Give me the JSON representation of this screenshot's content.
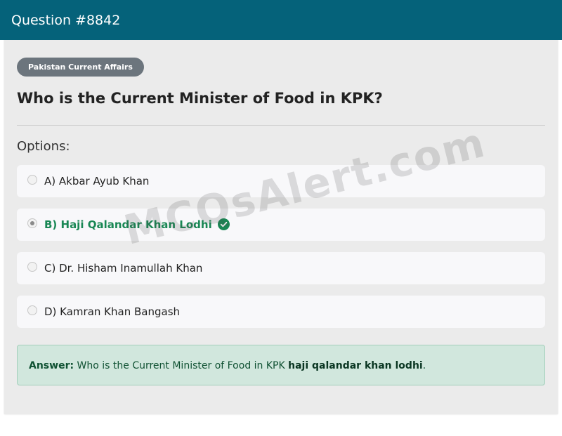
{
  "header": {
    "title": "Question #8842"
  },
  "category": "Pakistan Current Affairs",
  "question": "Who is the Current Minister of Food in KPK?",
  "options_label": "Options:",
  "options": [
    {
      "label": "A) Akbar Ayub Khan",
      "selected": false,
      "correct": false
    },
    {
      "label": "B) Haji Qalandar Khan Lodhi",
      "selected": true,
      "correct": true
    },
    {
      "label": "C) Dr. Hisham Inamullah Khan",
      "selected": false,
      "correct": false
    },
    {
      "label": "D) Kamran Khan Bangash",
      "selected": false,
      "correct": false
    }
  ],
  "answer": {
    "label": "Answer:",
    "text": "Who is the Current Minister of Food in KPK",
    "value": "haji qalandar khan lodhi",
    "suffix": "."
  },
  "watermark": "MCQsAlert.com",
  "colors": {
    "header_bg": "#05627a",
    "correct": "#198754",
    "answer_bg": "#d1e7dd",
    "badge_bg": "#6c757d"
  },
  "icons": {
    "correct": "check-circle-icon"
  }
}
